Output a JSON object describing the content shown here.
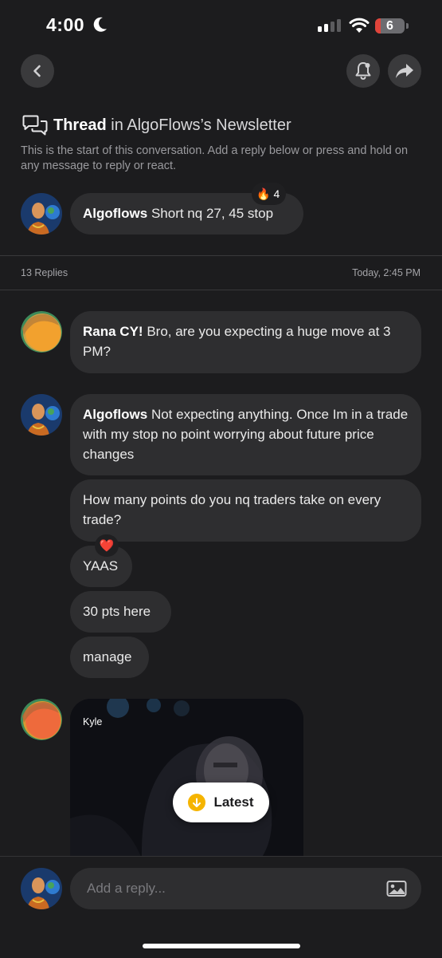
{
  "status_bar": {
    "time": "4:00",
    "battery": "6"
  },
  "header": {
    "thread_label": "Thread",
    "thread_context": "in AlgoFlows’s Newsletter",
    "description": "This is the start of this conversation. Add a reply below or press and hold on any message to reply or react."
  },
  "original_post": {
    "sender": "Algoflows",
    "text": "Short nq 27, 45 stop",
    "reaction_emoji": "🔥",
    "reaction_count": "4"
  },
  "thread_meta": {
    "replies": "13 Replies",
    "timestamp": "Today, 2:45 PM"
  },
  "messages": [
    {
      "sender": "Rana CY!",
      "text": "Bro, are you expecting a huge move at 3 PM?"
    },
    {
      "sender": "Algoflows",
      "text": "Not expecting anything. Once Im in a trade with my stop no point worrying about future price changes"
    },
    {
      "sender": "",
      "text": "How many points do you nq traders take on every trade?"
    },
    {
      "sender": "",
      "text": "YAAS",
      "reaction_emoji": "❤️"
    },
    {
      "sender": "",
      "text": "30 pts here"
    },
    {
      "sender": "",
      "text": "manage"
    }
  ],
  "media_message": {
    "sender": "Kyle"
  },
  "latest_button": {
    "label": "Latest"
  },
  "composer": {
    "placeholder": "Add a reply..."
  },
  "colors": {
    "background": "#1c1c1e",
    "bubble": "#2e2e30",
    "latest_accent": "#f5b400",
    "battery_low": "#e0443b"
  },
  "icons": [
    "back-icon",
    "bell-icon",
    "share-icon",
    "thread-icon",
    "image-icon",
    "down-arrow-icon"
  ]
}
